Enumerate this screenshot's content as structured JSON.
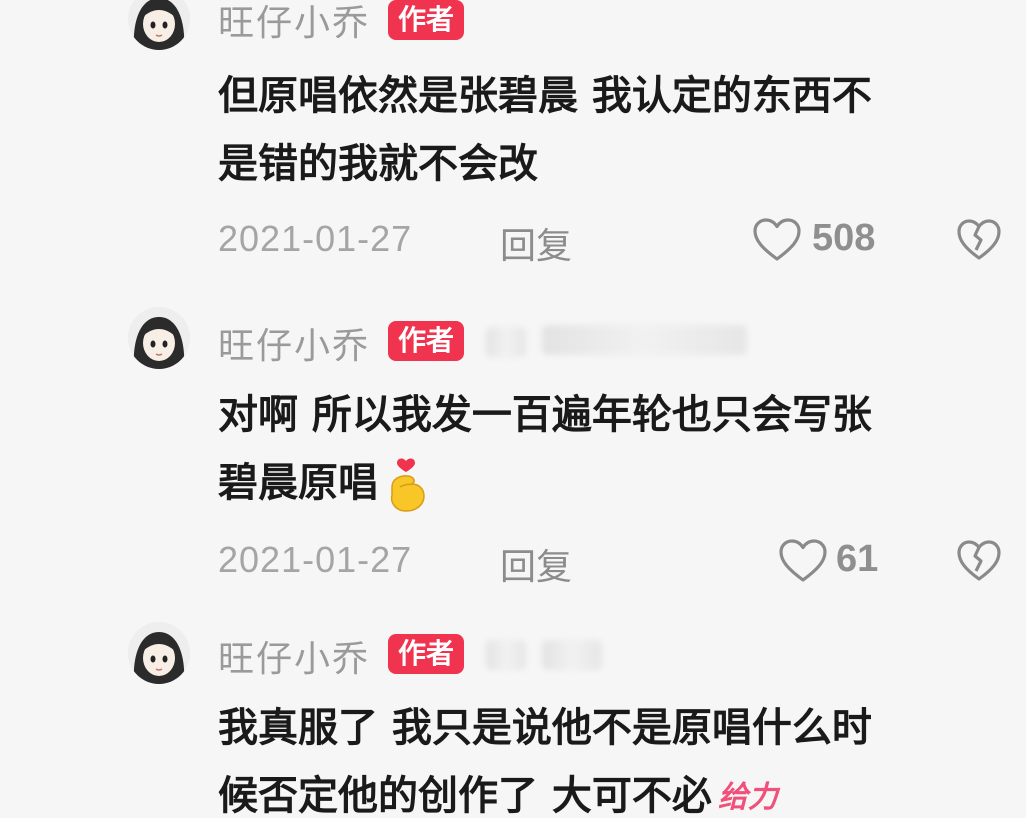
{
  "comments": [
    {
      "username": "旺仔小乔",
      "badge": "作者",
      "text_lines": [
        "但原唱依然是张碧晨 我认定的东西不",
        "是错的我就不会改"
      ],
      "date": "2021-01-27",
      "reply_label": "回复",
      "likes": "508"
    },
    {
      "username": "旺仔小乔",
      "badge": "作者",
      "text_lines": [
        "对啊 所以我发一百遍年轮也只会写张",
        "碧晨原唱"
      ],
      "emoji": "finger-heart-emoji",
      "date": "2021-01-27",
      "reply_label": "回复",
      "likes": "61"
    },
    {
      "username": "旺仔小乔",
      "badge": "作者",
      "text_lines": [
        "我真服了 我只是说他不是原唱什么时",
        "候否定他的创作了 大可不必"
      ],
      "sticker": "给力"
    }
  ],
  "icons": {
    "like": "heart-outline-icon",
    "dislike": "broken-heart-icon"
  },
  "colors": {
    "badge": "#f0334f",
    "text": "#1a1a1a",
    "muted": "#a5a5a5",
    "background": "#f6f6f6"
  }
}
